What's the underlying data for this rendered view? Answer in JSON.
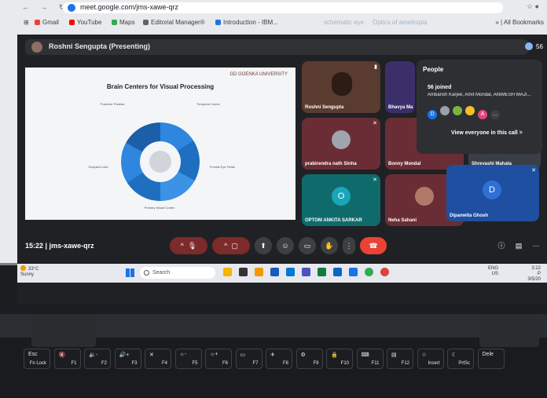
{
  "browser": {
    "url": "meet.google.com/jms-xawe-qrz",
    "bookmarks": [
      "Gmail",
      "YouTube",
      "Maps",
      "Editorial Manager®",
      "Introduction - IBM...",
      "schematic eye",
      "Optics of ametropia"
    ],
    "all_bookmarks_label": "All Bookmarks"
  },
  "meet": {
    "presenter_label": "Roshni Sengupta (Presenting)",
    "participant_count": "56",
    "meeting_time": "15:22",
    "meeting_code": "jms-xawe-qrz"
  },
  "slide": {
    "title": "Brain Centers for Visual Processing",
    "logo": "GD GOENKA UNIVERSITY",
    "notes": [
      "Posterior Parietal",
      "Temporal Cortex",
      "Occipital Lobe",
      "Frontal Eye Fields",
      "Primary Visual Cortex"
    ]
  },
  "tiles": [
    {
      "name": "Roshni Sengupta",
      "color": "#5a3b2f"
    },
    {
      "name": "Bhavya Ma",
      "color": "#3b2f6b"
    },
    {
      "name": "prabirendra nath Sinha",
      "color": "#6b2d35"
    },
    {
      "name": "Bonny Mondal",
      "color": "#6b2d35"
    },
    {
      "name": "Shreyashi Mahata",
      "color": "#3a3f47"
    },
    {
      "name": "OPTOM ANKITA SARKAR",
      "initial": "O",
      "color": "#0f6b6b",
      "avatar_color": "#1aa5b8"
    },
    {
      "name": "Neha Sahani",
      "color": "#6b2d35"
    },
    {
      "name": "Dipanwita Ghosh",
      "initial": "D",
      "color": "#1e4fa0",
      "avatar_color": "#2f6fd6"
    }
  ],
  "people_panel": {
    "title": "People",
    "joined": "56 joined",
    "names": "Ambarish Karjee, Amit Mondal, ANIMESH MAJI...",
    "avatars": [
      {
        "t": "D",
        "c": "#1a73e8"
      },
      {
        "t": "",
        "c": "#9aa0a6"
      },
      {
        "t": "",
        "c": "#7cb342"
      },
      {
        "t": "",
        "c": "#f6bf26"
      },
      {
        "t": "A",
        "c": "#e8437a"
      },
      {
        "t": "…",
        "c": "#3c4043"
      }
    ],
    "link": "View everyone in this call  >"
  },
  "taskbar": {
    "temp": "33°C",
    "weather": "Sunny",
    "search_placeholder": "Search",
    "lang1": "ENG",
    "lang2": "US",
    "time": "3:22 P",
    "date": "3/5/20"
  },
  "keys": [
    {
      "a": "Esc",
      "b": "Fn Lock"
    },
    {
      "a": "🔇",
      "b": "F1"
    },
    {
      "a": "🔉-",
      "b": "F2"
    },
    {
      "a": "🔊+",
      "b": "F3"
    },
    {
      "a": "✕",
      "b": "F4"
    },
    {
      "a": "☼-",
      "b": "F5"
    },
    {
      "a": "☼+",
      "b": "F6"
    },
    {
      "a": "▭",
      "b": "F7"
    },
    {
      "a": "✈",
      "b": "F8"
    },
    {
      "a": "⚙",
      "b": "F9"
    },
    {
      "a": "🔒",
      "b": "F10"
    },
    {
      "a": "⌨",
      "b": "F11"
    },
    {
      "a": "▤",
      "b": "F12"
    },
    {
      "a": "☆",
      "b": "Insert"
    },
    {
      "a": "☾",
      "b": "PrtSc"
    },
    {
      "a": "Dele",
      "b": ""
    }
  ]
}
